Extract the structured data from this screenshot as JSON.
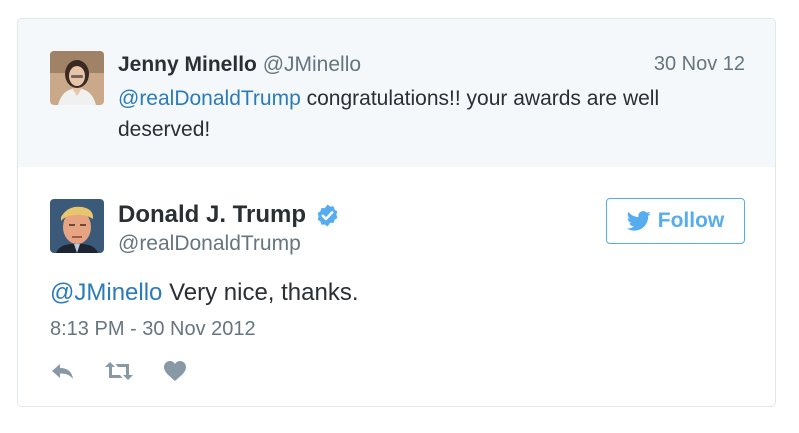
{
  "parent_tweet": {
    "author_name": "Jenny Minello",
    "author_handle": "@JMinello",
    "date": "30 Nov 12",
    "mention": "@realDonaldTrump",
    "text_line1": " congratulations!! your awards are well",
    "text_line2": "deserved!"
  },
  "main_tweet": {
    "author_name": "Donald J. Trump",
    "author_handle": "@realDonaldTrump",
    "follow_label": "Follow",
    "mention": "@JMinello",
    "text": " Very nice, thanks.",
    "timestamp": "8:13 PM - 30 Nov 2012"
  },
  "icons": {
    "verified": "verified-badge-icon",
    "bird": "twitter-bird-icon",
    "reply": "reply-icon",
    "retweet": "retweet-icon",
    "like": "heart-icon"
  },
  "colors": {
    "link_blue": "#2b7bb9",
    "twitter_blue": "#55acee",
    "gray_text": "#66757f",
    "parent_background": "#f5f8fa",
    "border": "#e1e8ed",
    "action_gray": "#8899a6"
  }
}
